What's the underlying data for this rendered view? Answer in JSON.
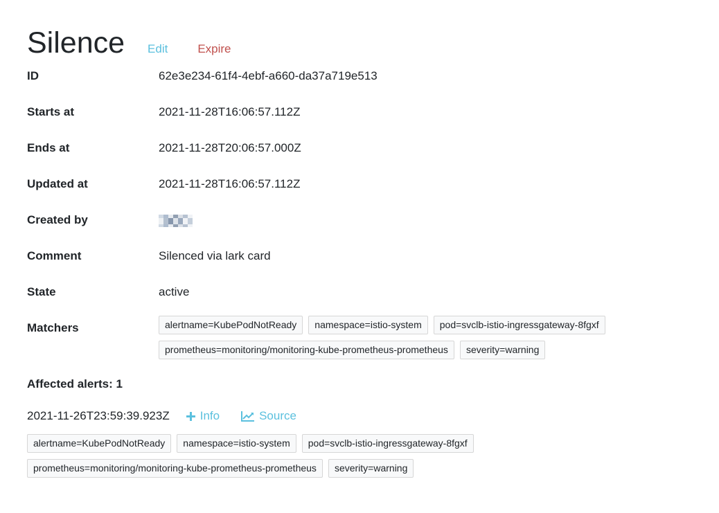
{
  "header": {
    "title": "Silence",
    "edit_label": "Edit",
    "expire_label": "Expire"
  },
  "fields": {
    "id": {
      "label": "ID",
      "value": "62e3e234-61f4-4ebf-a660-da37a719e513"
    },
    "starts_at": {
      "label": "Starts at",
      "value": "2021-11-28T16:06:57.112Z"
    },
    "ends_at": {
      "label": "Ends at",
      "value": "2021-11-28T20:06:57.000Z"
    },
    "updated_at": {
      "label": "Updated at",
      "value": "2021-11-28T16:06:57.112Z"
    },
    "created_by": {
      "label": "Created by"
    },
    "comment": {
      "label": "Comment",
      "value": "Silenced via lark card"
    },
    "state": {
      "label": "State",
      "value": "active"
    },
    "matchers": {
      "label": "Matchers",
      "items": [
        "alertname=KubePodNotReady",
        "namespace=istio-system",
        "pod=svclb-istio-ingressgateway-8fgxf",
        "prometheus=monitoring/monitoring-kube-prometheus-prometheus",
        "severity=warning"
      ]
    }
  },
  "affected": {
    "heading": "Affected alerts: 1",
    "alerts": [
      {
        "timestamp": "2021-11-26T23:59:39.923Z",
        "info_label": "Info",
        "source_label": "Source",
        "labels": [
          "alertname=KubePodNotReady",
          "namespace=istio-system",
          "pod=svclb-istio-ingressgateway-8fgxf",
          "prometheus=monitoring/monitoring-kube-prometheus-prometheus",
          "severity=warning"
        ]
      }
    ]
  },
  "colors": {
    "link": "#5bc0de",
    "danger": "#c0504d",
    "tag_border": "#d6d6d6",
    "text": "#212529"
  },
  "icons": {
    "info": "plus-icon",
    "source": "line-chart-icon",
    "created_by": "redacted-avatar"
  }
}
